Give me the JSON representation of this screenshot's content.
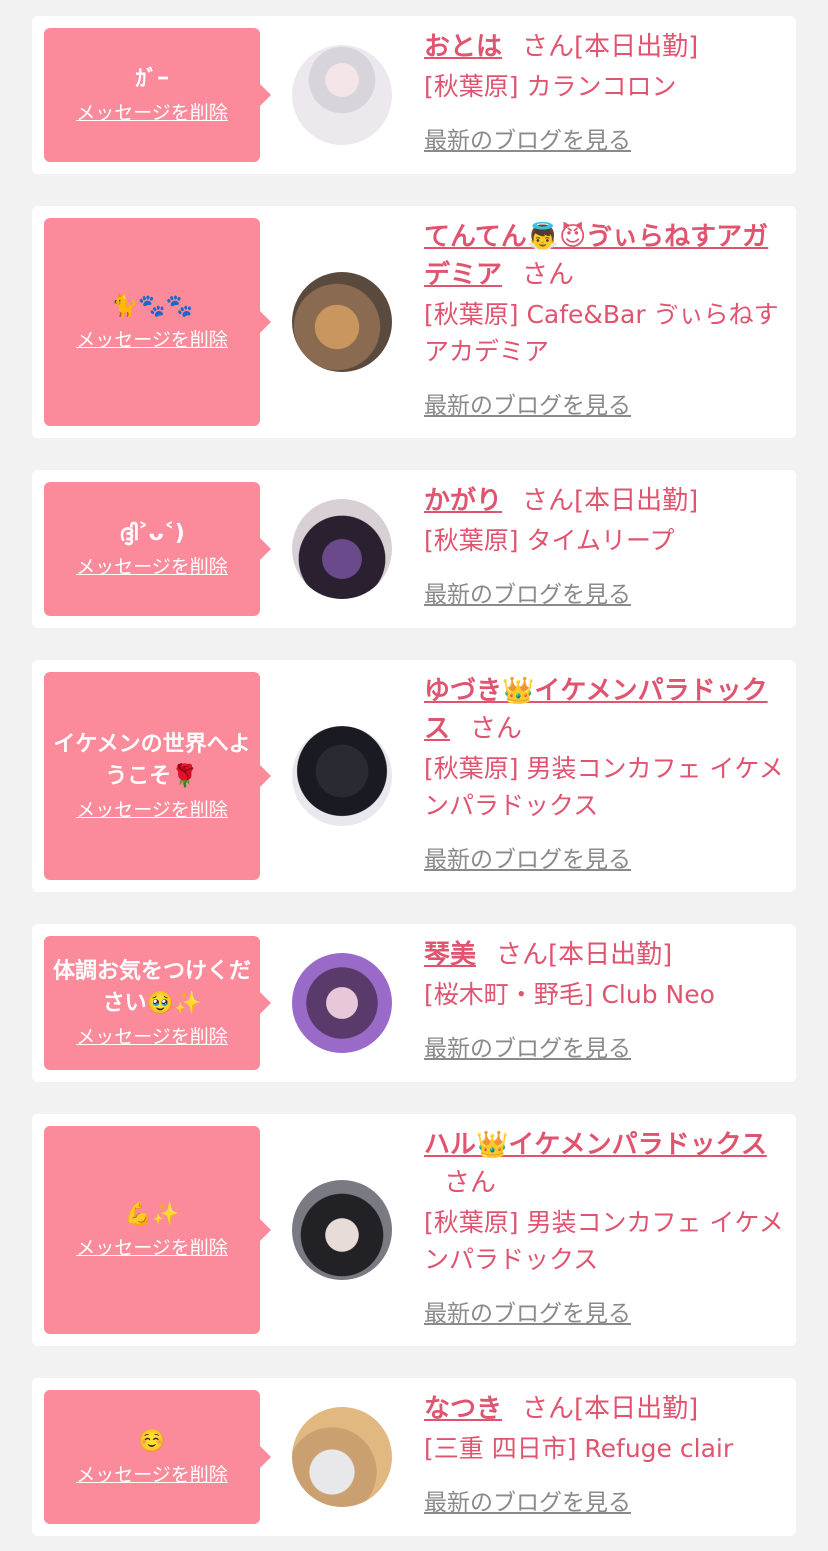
{
  "delete_label": "メッセージを削除",
  "blog_label": "最新のブログを見る",
  "san_label": "さん",
  "colors": {
    "accent": "#e0546f",
    "bubble": "#fb8a9b",
    "link_gray": "#8a8a8a"
  },
  "messages": [
    {
      "text": "ｶﾞｰ",
      "name": "おとは",
      "status": "[本日出勤]",
      "shop": "[秋葉原] カランコロン"
    },
    {
      "text": "🐈🐾🐾",
      "name": "てんてん👼😈ゔぃらねすアガデミア",
      "status": "",
      "shop": "[秋葉原] Cafe&Bar ゔぃらねすアカデミア"
    },
    {
      "text": "ദ്ദി˃ᴗ˂)",
      "name": "かがり",
      "status": "[本日出勤]",
      "shop": "[秋葉原] タイムリープ"
    },
    {
      "text": "イケメンの世界へようこそ🌹",
      "name": "ゆづき👑イケメンパラドックス",
      "status": "",
      "shop": "[秋葉原] 男装コンカフェ イケメンパラドックス"
    },
    {
      "text": "体調お気をつけください🥹✨",
      "name": "琴美",
      "status": "[本日出勤]",
      "shop": "[桜木町・野毛] Club Neo"
    },
    {
      "text": "💪✨",
      "name": "ハル👑イケメンパラドックス",
      "status": "",
      "shop": "[秋葉原] 男装コンカフェ イケメンパラドックス"
    },
    {
      "text": "☺️",
      "name": "なつき",
      "status": "[本日出勤]",
      "shop": "[三重 四日市] Refuge clair"
    }
  ]
}
